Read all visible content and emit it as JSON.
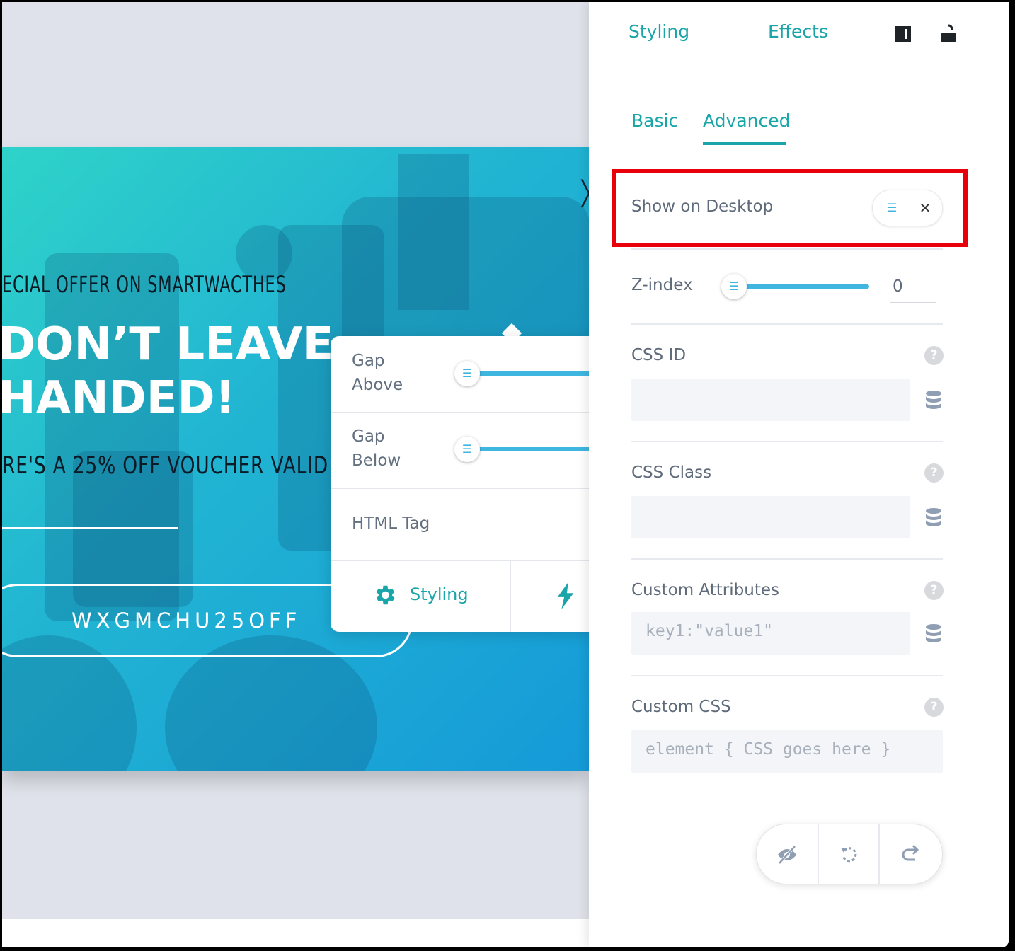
{
  "canvas": {
    "offer_text": "ECIAL OFFER ON SMARTWACTHES",
    "headline_line1": "DON’T LEAVE",
    "headline_line2": "HANDED!",
    "voucher_text": "RE'S A 25% OFF VOUCHER VALID",
    "code": "WXGMCHU25OFF"
  },
  "float_panel": {
    "gap_above": "Gap\nAbove",
    "gap_below": "Gap\nBelow",
    "html_tag": "HTML Tag",
    "styling_label": "Styling"
  },
  "top_tabs": {
    "styling": "Styling",
    "effects": "Effects"
  },
  "sub_tabs": {
    "basic": "Basic",
    "advanced": "Advanced"
  },
  "settings": {
    "show_on_desktop": "Show on Desktop",
    "z_index_label": "Z-index",
    "z_index_value": "0",
    "css_id_label": "CSS ID",
    "css_class_label": "CSS Class",
    "custom_attributes_label": "Custom Attributes",
    "custom_attributes_placeholder": "key1:\"value1\"",
    "custom_css_label": "Custom CSS",
    "custom_css_placeholder": "element { CSS goes here }"
  },
  "colors": {
    "accent": "#1aa5a8",
    "slider": "#3fb6e0",
    "highlight": "#e8000b"
  }
}
